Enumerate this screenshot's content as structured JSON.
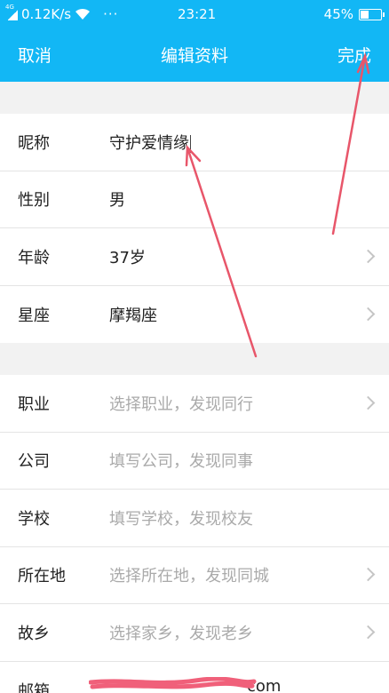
{
  "status_bar": {
    "network_type": "4G",
    "speed": "0.12K/s",
    "time": "23:21",
    "battery_percent": "45%",
    "battery_level": 0.45,
    "more": "···"
  },
  "nav": {
    "cancel": "取消",
    "title": "编辑资料",
    "done": "完成"
  },
  "group1": [
    {
      "label": "昵称",
      "value": "守护爱情缘",
      "placeholder": false,
      "chevron": false
    },
    {
      "label": "性别",
      "value": "男",
      "placeholder": false,
      "chevron": false
    },
    {
      "label": "年龄",
      "value": "37岁",
      "placeholder": false,
      "chevron": true
    },
    {
      "label": "星座",
      "value": "摩羯座",
      "placeholder": false,
      "chevron": true
    }
  ],
  "group2": [
    {
      "label": "职业",
      "value": "选择职业，发现同行",
      "placeholder": true,
      "chevron": true
    },
    {
      "label": "公司",
      "value": "填写公司，发现同事",
      "placeholder": true,
      "chevron": false
    },
    {
      "label": "学校",
      "value": "填写学校，发现校友",
      "placeholder": true,
      "chevron": false
    },
    {
      "label": "所在地",
      "value": "选择所在地，发现同城",
      "placeholder": true,
      "chevron": true
    },
    {
      "label": "故乡",
      "value": "选择家乡，发现老乡",
      "placeholder": true,
      "chevron": true
    },
    {
      "label": "邮箱",
      "value": "",
      "placeholder": false,
      "chevron": false
    }
  ],
  "email_visible_suffix": "com",
  "colors": {
    "header": "#12b7f5",
    "annotation_arrow": "#e8566a",
    "placeholder_text": "#aaaaaa"
  },
  "icons": [
    "signal-icon",
    "wifi-icon",
    "battery-icon",
    "chevron-right-icon"
  ]
}
